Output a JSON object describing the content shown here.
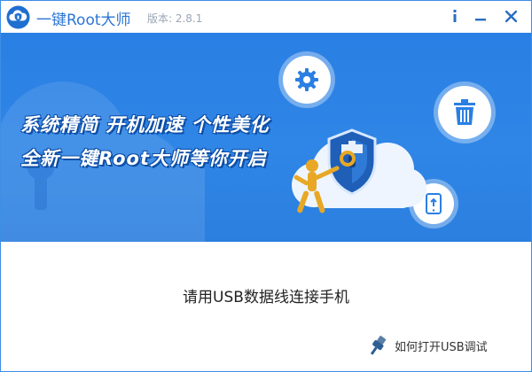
{
  "window": {
    "title": "一键Root大师",
    "version": "版本: 2.8.1",
    "logo_icon": "cloud-shield-logo",
    "accent_color": "#2a7fe4"
  },
  "titlebar_buttons": [
    {
      "name": "info",
      "icon": "info-icon"
    },
    {
      "name": "minimize",
      "icon": "minimize-icon"
    },
    {
      "name": "close",
      "icon": "close-icon"
    }
  ],
  "banner": {
    "slogan_line1": "系统精简 开机加速 个性美化",
    "slogan_line2": "全新一键Root大师等你开启",
    "feature_icons": [
      "gear-icon",
      "trash-icon",
      "phone-icon"
    ],
    "illustration": "cloud-shield-with-key-figure"
  },
  "main": {
    "connect_prompt": "请用USB数据线连接手机",
    "usb_help_link": "如何打开USB调试",
    "usb_help_icon": "usb-cable-icon"
  }
}
